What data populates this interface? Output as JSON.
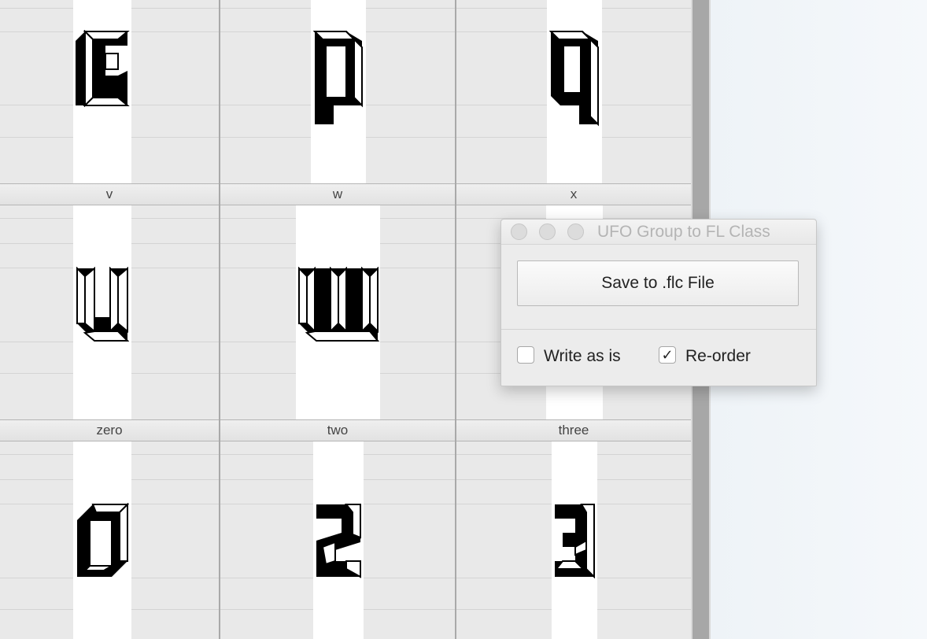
{
  "glyph_labels": {
    "row2": [
      "v",
      "w",
      "x"
    ],
    "row3": [
      "zero",
      "two",
      "three"
    ]
  },
  "palette": {
    "title": "UFO Group to FL Class",
    "save_button": "Save to .flc File",
    "options": [
      {
        "label": "Write as is",
        "checked": false
      },
      {
        "label": "Re-order",
        "checked": true
      }
    ],
    "check_mark": "✓"
  }
}
